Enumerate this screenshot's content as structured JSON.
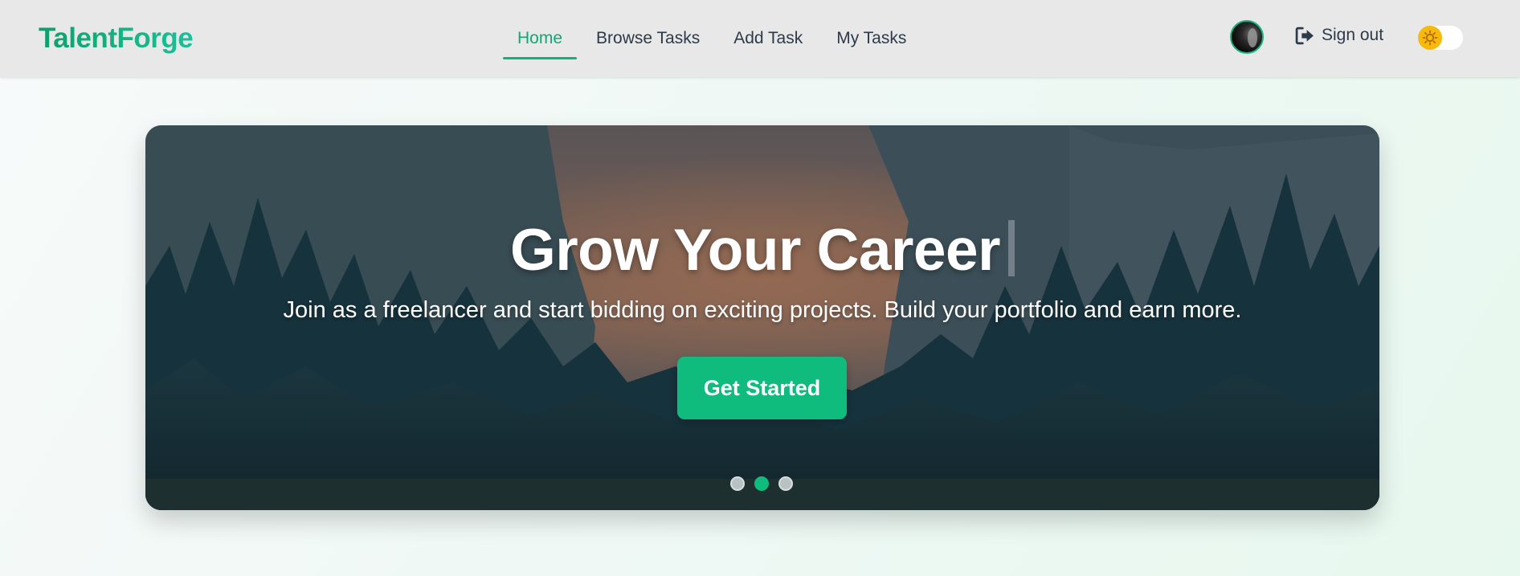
{
  "brand": {
    "name": "TalentForge"
  },
  "nav": {
    "links": [
      {
        "label": "Home",
        "active": true
      },
      {
        "label": "Browse Tasks",
        "active": false
      },
      {
        "label": "Add Task",
        "active": false
      },
      {
        "label": "My Tasks",
        "active": false
      }
    ],
    "avatar_icon": "user-avatar",
    "signout": {
      "label": "Sign out",
      "icon": "sign-out-icon"
    },
    "theme_toggle": {
      "icon": "sun-icon",
      "mode": "light"
    }
  },
  "hero": {
    "title": "Grow Your Career",
    "subtitle": "Join as a freelancer and start bidding on exciting projects. Build your portfolio and earn more.",
    "cta_label": "Get Started",
    "slides_total": 3,
    "active_slide": 2
  },
  "colors": {
    "accent": "#10bc7d",
    "brand": "#10a874",
    "navbar_bg": "#e8e8e8",
    "text_dark": "#2d3a4a",
    "toggle_sun": "#f7b90a"
  }
}
